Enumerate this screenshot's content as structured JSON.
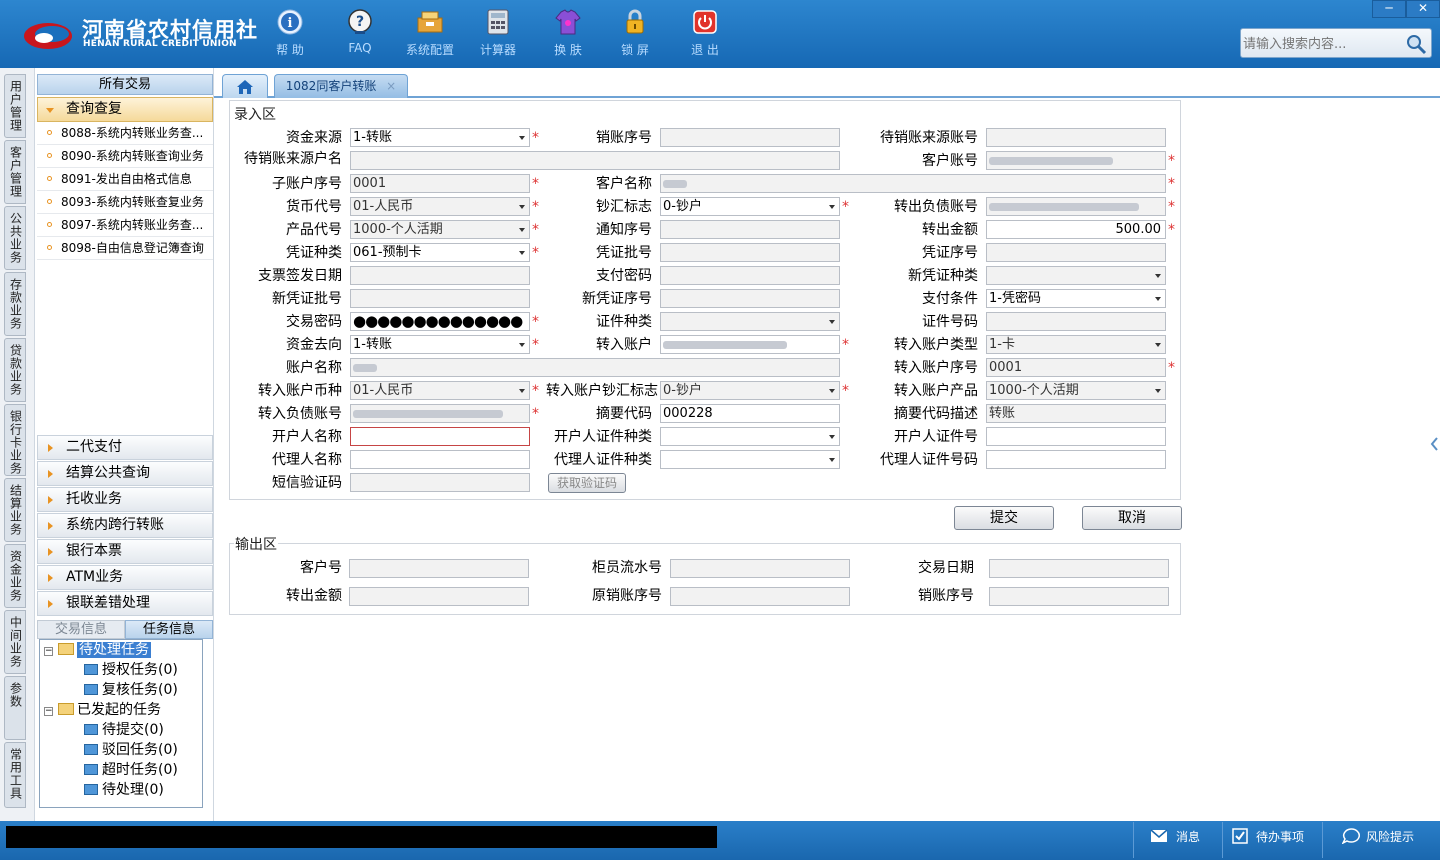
{
  "app": {
    "title_cn": "河南省农村信用社",
    "title_en": "HENAN RURAL CREDIT UNION"
  },
  "toolbar": [
    {
      "label": "帮 助",
      "icon": "help-icon"
    },
    {
      "label": "FAQ",
      "icon": "faq-icon"
    },
    {
      "label": "系统配置",
      "icon": "config-icon"
    },
    {
      "label": "计算器",
      "icon": "calculator-icon"
    },
    {
      "label": "换 肤",
      "icon": "skin-icon"
    },
    {
      "label": "锁 屏",
      "icon": "lock-icon"
    },
    {
      "label": "退 出",
      "icon": "exit-icon"
    }
  ],
  "window": {
    "minimize": "─",
    "close": "✕"
  },
  "search": {
    "placeholder": "请输入搜索内容..."
  },
  "vtabs": [
    "用户管理",
    "客户管理",
    "公共业务",
    "存款业务",
    "贷款业务",
    "银行卡业务",
    "结算业务",
    "资金业务",
    "中间业务",
    "参数",
    "常用工具"
  ],
  "left": {
    "header": "所有交易",
    "open_group": "查询查复",
    "items": [
      "8088-系统内转账业务查...",
      "8090-系统内转账查询业务",
      "8091-发出自由格式信息",
      "8093-系统内转账查复业务",
      "8097-系统内转账业务查...",
      "8098-自由信息登记簿查询"
    ],
    "groups": [
      "二代支付",
      "结算公共查询",
      "托收业务",
      "系统内跨行转账",
      "银行本票",
      "ATM业务",
      "银联差错处理"
    ],
    "task_tabs": [
      "交易信息",
      "任务信息"
    ],
    "tree": {
      "pending": "待处理任务",
      "auth": "授权任务(0)",
      "review": "复核任务(0)",
      "initiated": "已发起的任务",
      "to_submit": "待提交(0)",
      "rejected": "驳回任务(0)",
      "timeout": "超时任务(0)",
      "todo": "待处理(0)"
    }
  },
  "tabs": {
    "home": "home-icon",
    "active": "1082同客户转账",
    "close": "×"
  },
  "entry": {
    "title": "录入区",
    "labels": {
      "fund_source": "资金来源",
      "cancel_seq": "销账序号",
      "pending_src_acct": "待销账来源账号",
      "pending_src_name": "待销账来源户名",
      "cust_acct": "客户账号",
      "sub_seq": "子账户序号",
      "cust_name": "客户名称",
      "currency": "货币代号",
      "cash_flag": "钞汇标志",
      "out_debt": "转出负债账号",
      "product": "产品代号",
      "notice_seq": "通知序号",
      "out_amount": "转出金额",
      "voucher_type": "凭证种类",
      "voucher_batch": "凭证批号",
      "voucher_seq": "凭证序号",
      "cheque_date": "支票签发日期",
      "pay_pwd": "支付密码",
      "new_voucher_type": "新凭证种类",
      "new_voucher_batch": "新凭证批号",
      "new_voucher_seq": "新凭证序号",
      "pay_cond": "支付条件",
      "txn_pwd": "交易密码",
      "id_type": "证件种类",
      "id_no": "证件号码",
      "fund_dest": "资金去向",
      "in_acct": "转入账户",
      "in_acct_type": "转入账户类型",
      "acct_name": "账户名称",
      "in_acct_seq": "转入账户序号",
      "in_currency": "转入账户币种",
      "in_cash_flag": "转入账户钞汇标志",
      "in_product": "转入账户产品",
      "in_debt": "转入负债账号",
      "summary_code": "摘要代码",
      "summary_desc": "摘要代码描述",
      "opener_name": "开户人名称",
      "opener_id_type": "开户人证件种类",
      "opener_id_no": "开户人证件号",
      "agent_name": "代理人名称",
      "agent_id_type": "代理人证件种类",
      "agent_id_no": "代理人证件号码",
      "sms_code": "短信验证码"
    },
    "values": {
      "fund_source": "1-转账",
      "sub_seq": "0001",
      "currency": "01-人民币",
      "cash_flag": "0-钞户",
      "product": "1000-个人活期",
      "out_amount": "500.00",
      "voucher_type": "061-预制卡",
      "pay_cond": "1-凭密码",
      "txn_pwd": "●●●●●●●●●●●●●●",
      "fund_dest": "1-转账",
      "in_acct_type": "1-卡",
      "in_acct_seq": "0001",
      "in_currency": "01-人民币",
      "in_cash_flag": "0-钞户",
      "in_product": "1000-个人活期",
      "summary_code": "000228",
      "summary_desc": "转账"
    },
    "get_code": "获取验证码",
    "required": "*"
  },
  "actions": {
    "submit": "提交",
    "cancel": "取消"
  },
  "output": {
    "title": "输出区",
    "labels": {
      "cust_no": "客户号",
      "teller_seq": "柜员流水号",
      "txn_date": "交易日期",
      "out_amount": "转出金额",
      "orig_cancel_seq": "原销账序号",
      "cancel_seq": "销账序号"
    }
  },
  "status": {
    "message": "消息",
    "todo": "待办事项",
    "risk": "风险提示"
  }
}
